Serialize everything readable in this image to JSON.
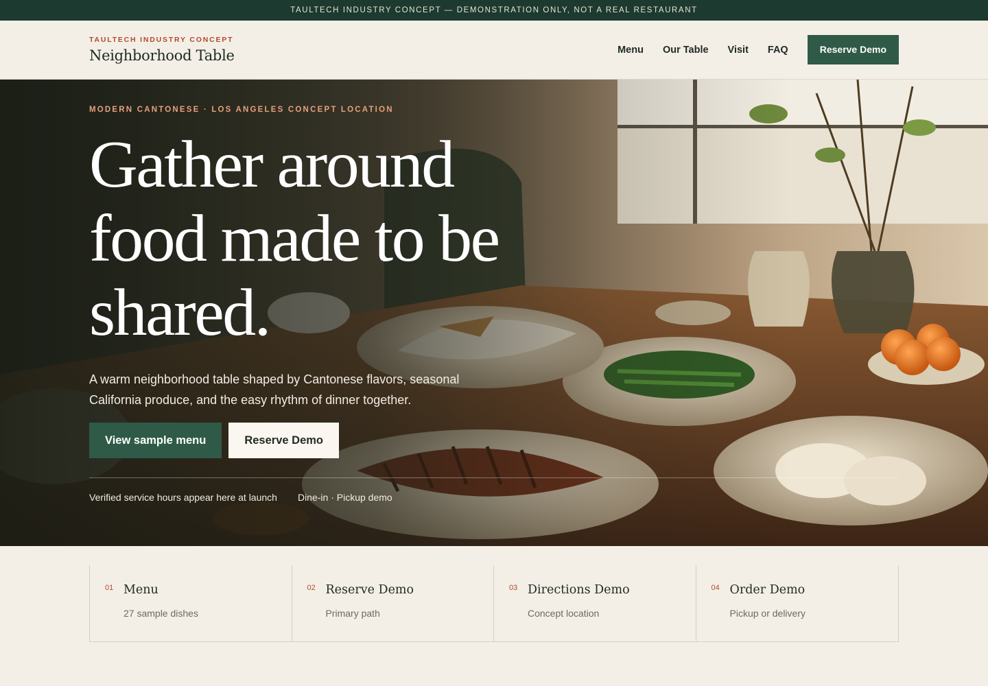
{
  "banner": {
    "text": "TAULTECH INDUSTRY CONCEPT — DEMONSTRATION ONLY, NOT A REAL RESTAURANT"
  },
  "header": {
    "eyebrow": "TAULTECH INDUSTRY CONCEPT",
    "brand": "Neighborhood Table",
    "nav": [
      "Menu",
      "Our Table",
      "Visit",
      "FAQ"
    ],
    "cta": "Reserve Demo"
  },
  "hero": {
    "eyebrow": "MODERN CANTONESE · LOS ANGELES CONCEPT LOCATION",
    "title": "Gather around food made to be shared.",
    "subtitle": "A warm neighborhood table shaped by Cantonese flavors, seasonal California produce, and the easy rhythm of dinner together.",
    "primary_cta": "View sample menu",
    "secondary_cta": "Reserve Demo",
    "meta": [
      "Verified service hours appear here at launch",
      "Dine-in · Pickup demo"
    ],
    "image_icon": "family-style-table-photo"
  },
  "quick_links": [
    {
      "num": "01",
      "title": "Menu",
      "sub": "27 sample dishes"
    },
    {
      "num": "02",
      "title": "Reserve Demo",
      "sub": "Primary path"
    },
    {
      "num": "03",
      "title": "Directions Demo",
      "sub": "Concept location"
    },
    {
      "num": "04",
      "title": "Order Demo",
      "sub": "Pickup or delivery"
    }
  ],
  "colors": {
    "brand_green": "#2f5a48",
    "banner_green": "#1c3a2f",
    "accent_rust": "#b24a2d",
    "cream": "#f3efe6"
  }
}
